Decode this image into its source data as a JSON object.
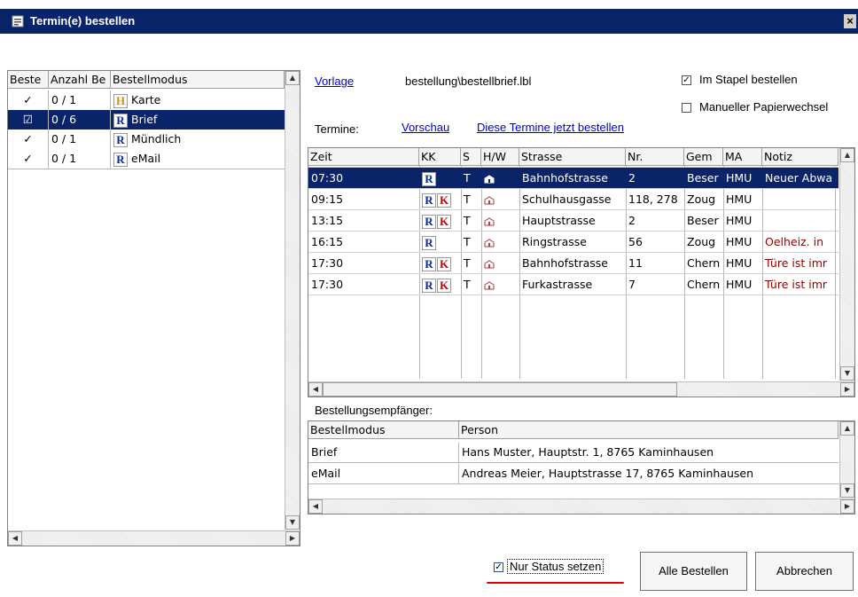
{
  "window": {
    "title": "Termin(e) bestellen",
    "close": "×"
  },
  "left_list": {
    "headers": [
      "Beste",
      "Anzahl Be",
      "Bestellmodus"
    ],
    "rows": [
      {
        "check": "✓",
        "count": "0 / 1",
        "icon": "H",
        "mode": "Karte"
      },
      {
        "check": "☑",
        "count": "0 / 6",
        "icon": "R",
        "mode": "Brief"
      },
      {
        "check": "✓",
        "count": "0 / 1",
        "icon": "R",
        "mode": "Mündlich"
      },
      {
        "check": "✓",
        "count": "0 / 1",
        "icon": "R",
        "mode": "eMail"
      }
    ]
  },
  "vorlage": {
    "link": "Vorlage",
    "path": "bestellung\\bestellbrief.lbl"
  },
  "options": {
    "stapel": "Im Stapel bestellen",
    "papier": "Manueller Papierwechsel"
  },
  "termine": {
    "label": "Termine:",
    "vorschau": "Vorschau",
    "bestellen": "Diese Termine jetzt bestellen"
  },
  "table": {
    "headers": [
      "Zeit",
      "KK",
      "S",
      "H/W",
      "Strasse",
      "Nr.",
      "Gem",
      "MA",
      "Notiz"
    ],
    "rows": [
      {
        "zeit": "07:30",
        "kk": [
          "R"
        ],
        "s": "T",
        "strasse": "Bahnhofstrasse",
        "nr": "2",
        "gem": "Beser",
        "ma": "HMU",
        "notiz": "Neuer Abwa"
      },
      {
        "zeit": "09:15",
        "kk": [
          "R",
          "K"
        ],
        "s": "T",
        "strasse": "Schulhausgasse",
        "nr": "118, 278",
        "gem": "Zoug",
        "ma": "HMU",
        "notiz": ""
      },
      {
        "zeit": "13:15",
        "kk": [
          "R",
          "K"
        ],
        "s": "T",
        "strasse": "Hauptstrasse",
        "nr": "2",
        "gem": "Beser",
        "ma": "HMU",
        "notiz": ""
      },
      {
        "zeit": "16:15",
        "kk": [
          "R"
        ],
        "s": "T",
        "strasse": "Ringstrasse",
        "nr": "56",
        "gem": "Zoug",
        "ma": "HMU",
        "notiz": "Oelheiz. in"
      },
      {
        "zeit": "17:30",
        "kk": [
          "R",
          "K"
        ],
        "s": "T",
        "strasse": "Bahnhofstrasse",
        "nr": "11",
        "gem": "Chern",
        "ma": "HMU",
        "notiz": "Türe ist imr"
      },
      {
        "zeit": "17:30",
        "kk": [
          "R",
          "K"
        ],
        "s": "T",
        "strasse": "Furkastrasse",
        "nr": "7",
        "gem": "Chern",
        "ma": "HMU",
        "notiz": "Türe ist imr"
      }
    ]
  },
  "recipients": {
    "label": "Bestellungsempfänger:",
    "headers": [
      "Bestellmodus",
      "Person"
    ],
    "rows": [
      {
        "mode": "Brief",
        "person": "Hans Muster, Hauptstr. 1, 8765 Kaminhausen"
      },
      {
        "mode": "eMail",
        "person": "Andreas Meier, Hauptstrasse 17, 8765 Kaminhausen"
      }
    ]
  },
  "footer": {
    "status": "Nur Status setzen",
    "alle": "Alle Bestellen",
    "abbrechen": "Abbrechen"
  },
  "colors": {
    "titlebar": "#0a246a",
    "selection": "#0a246a",
    "link": "#0000cc",
    "underline": "#e00000"
  }
}
